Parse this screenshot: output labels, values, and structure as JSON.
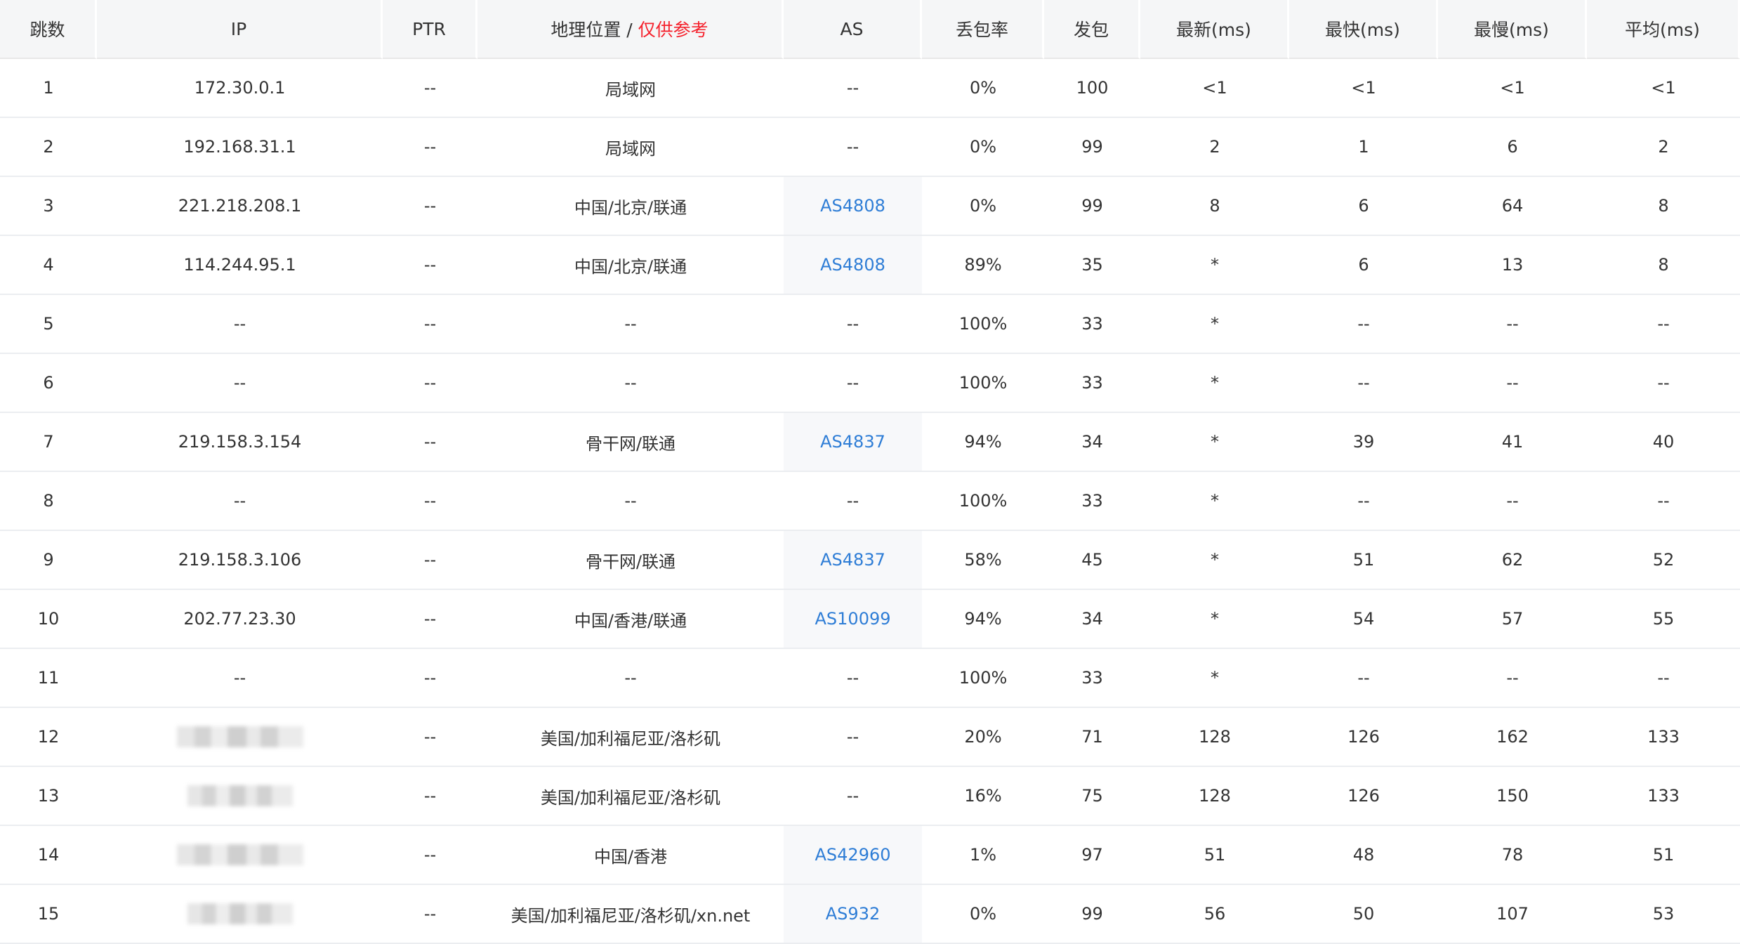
{
  "columns": {
    "hop": "跳数",
    "ip": "IP",
    "ptr": "PTR",
    "geo": "地理位置",
    "geo_sep": " / ",
    "geo_note": "仅供参考",
    "as": "AS",
    "loss": "丢包率",
    "sent": "发包",
    "last": "最新(ms)",
    "best": "最快(ms)",
    "worst": "最慢(ms)",
    "avg": "平均(ms)"
  },
  "rows": [
    {
      "hop": "1",
      "ip": "172.30.0.1",
      "ptr": "--",
      "geo": "局域网",
      "as": "--",
      "loss": "0%",
      "sent": "100",
      "last": "<1",
      "best": "<1",
      "worst": "<1",
      "avg": "<1"
    },
    {
      "hop": "2",
      "ip": "192.168.31.1",
      "ptr": "--",
      "geo": "局域网",
      "as": "--",
      "loss": "0%",
      "sent": "99",
      "last": "2",
      "best": "1",
      "worst": "6",
      "avg": "2"
    },
    {
      "hop": "3",
      "ip": "221.218.208.1",
      "ptr": "--",
      "geo": "中国/北京/联通",
      "as": "AS4808",
      "loss": "0%",
      "sent": "99",
      "last": "8",
      "best": "6",
      "worst": "64",
      "avg": "8"
    },
    {
      "hop": "4",
      "ip": "114.244.95.1",
      "ptr": "--",
      "geo": "中国/北京/联通",
      "as": "AS4808",
      "loss": "89%",
      "sent": "35",
      "last": "*",
      "best": "6",
      "worst": "13",
      "avg": "8"
    },
    {
      "hop": "5",
      "ip": "--",
      "ptr": "--",
      "geo": "--",
      "as": "--",
      "loss": "100%",
      "sent": "33",
      "last": "*",
      "best": "--",
      "worst": "--",
      "avg": "--"
    },
    {
      "hop": "6",
      "ip": "--",
      "ptr": "--",
      "geo": "--",
      "as": "--",
      "loss": "100%",
      "sent": "33",
      "last": "*",
      "best": "--",
      "worst": "--",
      "avg": "--"
    },
    {
      "hop": "7",
      "ip": "219.158.3.154",
      "ptr": "--",
      "geo": "骨干网/联通",
      "as": "AS4837",
      "loss": "94%",
      "sent": "34",
      "last": "*",
      "best": "39",
      "worst": "41",
      "avg": "40"
    },
    {
      "hop": "8",
      "ip": "--",
      "ptr": "--",
      "geo": "--",
      "as": "--",
      "loss": "100%",
      "sent": "33",
      "last": "*",
      "best": "--",
      "worst": "--",
      "avg": "--"
    },
    {
      "hop": "9",
      "ip": "219.158.3.106",
      "ptr": "--",
      "geo": "骨干网/联通",
      "as": "AS4837",
      "loss": "58%",
      "sent": "45",
      "last": "*",
      "best": "51",
      "worst": "62",
      "avg": "52"
    },
    {
      "hop": "10",
      "ip": "202.77.23.30",
      "ptr": "--",
      "geo": "中国/香港/联通",
      "as": "AS10099",
      "loss": "94%",
      "sent": "34",
      "last": "*",
      "best": "54",
      "worst": "57",
      "avg": "55"
    },
    {
      "hop": "11",
      "ip": "--",
      "ptr": "--",
      "geo": "--",
      "as": "--",
      "loss": "100%",
      "sent": "33",
      "last": "*",
      "best": "--",
      "worst": "--",
      "avg": "--"
    },
    {
      "hop": "12",
      "ip": "",
      "ptr": "--",
      "geo": "美国/加利福尼亚/洛杉矶",
      "as": "--",
      "loss": "20%",
      "sent": "71",
      "last": "128",
      "best": "126",
      "worst": "162",
      "avg": "133"
    },
    {
      "hop": "13",
      "ip": "",
      "ptr": "--",
      "geo": "美国/加利福尼亚/洛杉矶",
      "as": "--",
      "loss": "16%",
      "sent": "75",
      "last": "128",
      "best": "126",
      "worst": "150",
      "avg": "133"
    },
    {
      "hop": "14",
      "ip": "",
      "ptr": "--",
      "geo": "中国/香港",
      "as": "AS42960",
      "loss": "1%",
      "sent": "97",
      "last": "51",
      "best": "48",
      "worst": "78",
      "avg": "51"
    },
    {
      "hop": "15",
      "ip": "",
      "ptr": "--",
      "geo": "美国/加利福尼亚/洛杉矶/xn.net",
      "as": "AS932",
      "loss": "0%",
      "sent": "99",
      "last": "56",
      "best": "50",
      "worst": "107",
      "avg": "53"
    }
  ]
}
